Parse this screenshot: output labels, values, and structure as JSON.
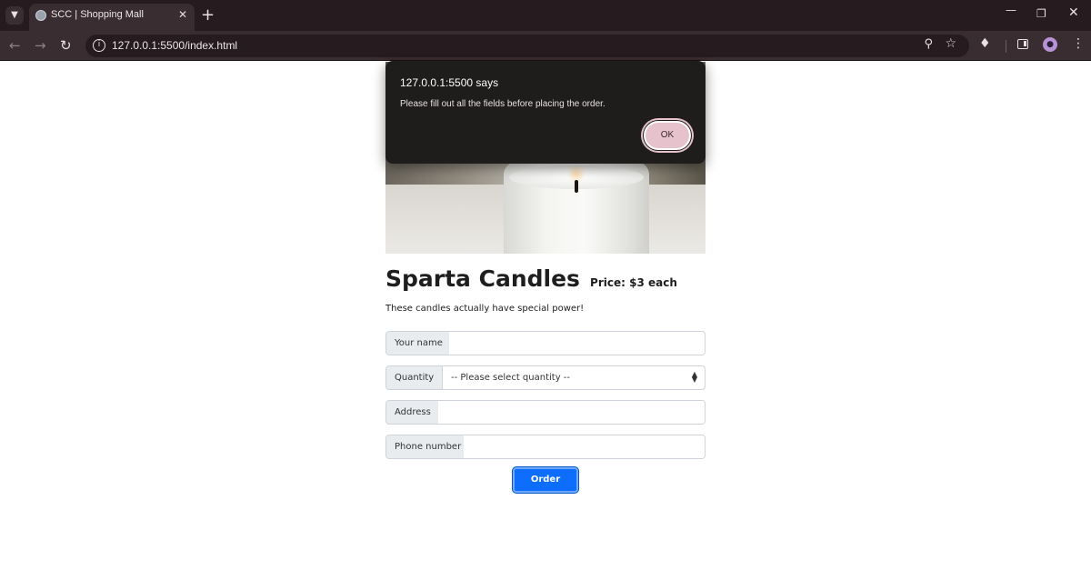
{
  "browser": {
    "tab_title": "SCC | Shopping Mall",
    "url": "127.0.0.1:5500/index.html",
    "icons": {
      "tab_menu": "chevron-down-icon",
      "tab_favicon": "globe-icon",
      "tab_close": "close-icon",
      "new_tab": "plus-icon",
      "minimize": "minimize-icon",
      "maximize": "maximize-icon",
      "close": "close-icon",
      "back": "arrow-left-icon",
      "forward": "arrow-right-icon",
      "reload": "reload-icon",
      "site_info": "info-icon",
      "zoom": "zoom-icon",
      "bookmark": "star-icon",
      "extensions": "puzzle-icon",
      "side_panel": "side-panel-icon",
      "profile": "profile-icon",
      "menu": "more-vertical-icon"
    }
  },
  "dialog": {
    "title": "127.0.0.1:5500 says",
    "message": "Please fill out all the fields before placing the order.",
    "ok_label": "OK"
  },
  "product": {
    "title": "Sparta Candles",
    "price": "Price: $3 each",
    "description": "These candles actually have special power!"
  },
  "form": {
    "name_label": "Your name",
    "name_value": "",
    "quantity_label": "Quantity",
    "quantity_selected": "-- Please select quantity --",
    "address_label": "Address",
    "address_value": "",
    "phone_label": "Phone number",
    "phone_value": "",
    "order_label": "Order"
  },
  "colors": {
    "primary_button": "#0d6efd",
    "dialog_bg": "#1f1c1c",
    "dialog_ok_bg": "#e6c2cd",
    "browser_frame": "#261b1f"
  }
}
